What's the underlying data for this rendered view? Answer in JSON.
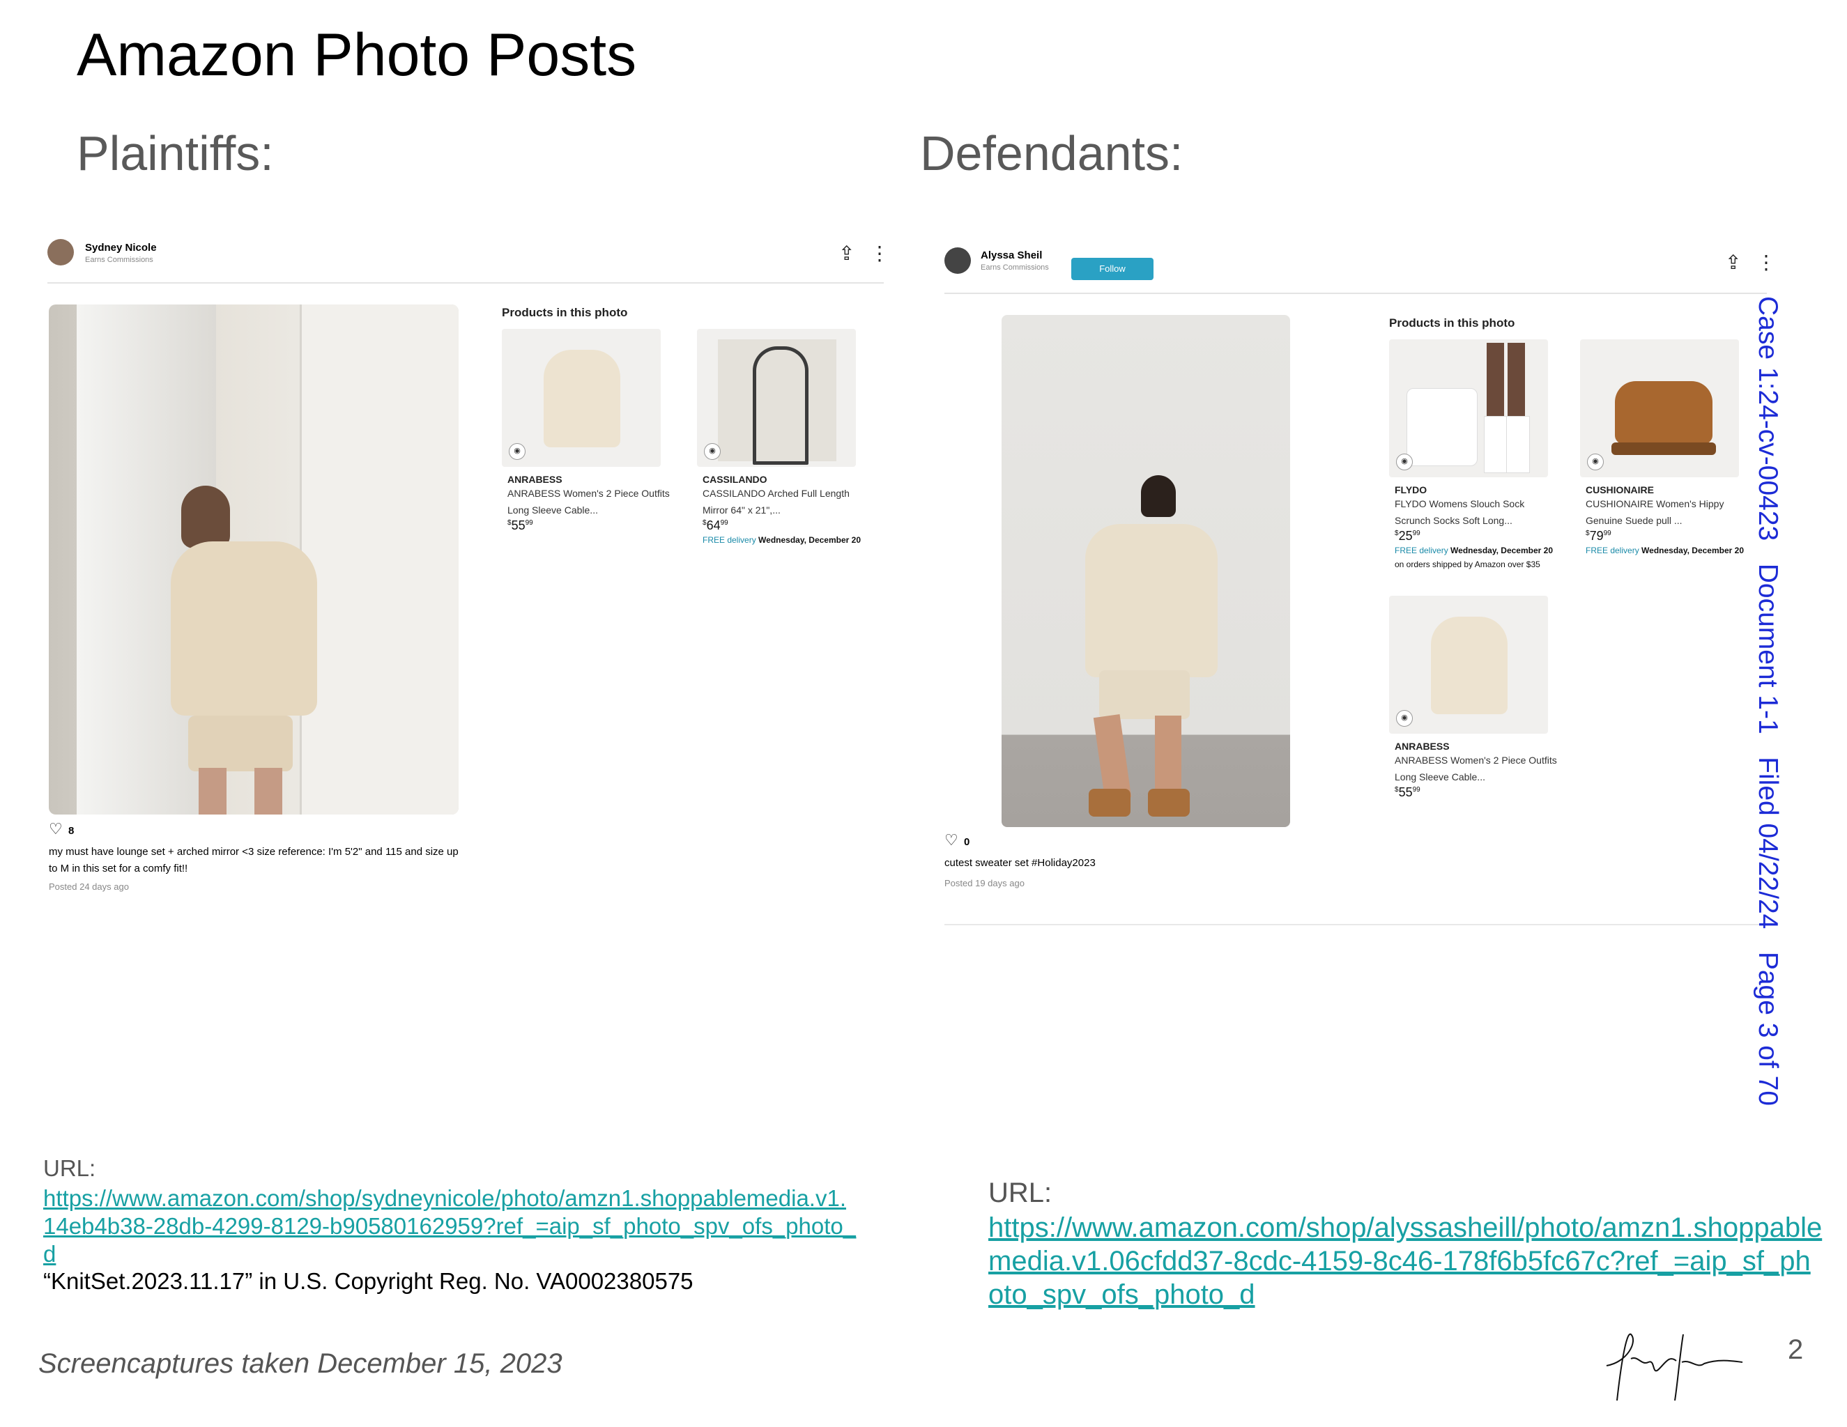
{
  "title": "Amazon Photo Posts",
  "plaintiffs_label": "Plaintiffs:",
  "defendants_label": "Defendants:",
  "left_post": {
    "user": "Sydney Nicole",
    "sub": "Earns Commissions",
    "products_header": "Products in this photo",
    "products": [
      {
        "brand": "ANRABESS",
        "desc": "ANRABESS Women's 2 Piece Outfits Long Sleeve Cable...",
        "price_whole": "55",
        "price_frac": "99"
      },
      {
        "brand": "CASSILANDO",
        "desc": "CASSILANDO Arched Full Length Mirror 64\" x 21\",...",
        "price_whole": "64",
        "price_frac": "99",
        "delivery_free": "FREE delivery",
        "delivery_date": "Wednesday, December 20"
      }
    ],
    "likes": "8",
    "caption": "my must have lounge set + arched mirror <3 size reference: I'm 5'2\" and 115 and size up to M in this set for a comfy fit!!",
    "posted": "Posted 24 days ago"
  },
  "right_post": {
    "user": "Alyssa Sheil",
    "sub": "Earns Commissions",
    "follow": "Follow",
    "products_header": "Products in this photo",
    "products": [
      {
        "brand": "FLYDO",
        "desc": "FLYDO Womens Slouch Sock Scrunch Socks Soft Long...",
        "price_whole": "25",
        "price_frac": "99",
        "delivery_free": "FREE delivery",
        "delivery_date": "Wednesday, December 20",
        "delivery_extra": "on orders shipped by Amazon over $35"
      },
      {
        "brand": "CUSHIONAIRE",
        "desc": "CUSHIONAIRE Women's Hippy Genuine Suede pull ...",
        "price_whole": "79",
        "price_frac": "99",
        "delivery_free": "FREE delivery",
        "delivery_date": "Wednesday, December 20"
      },
      {
        "brand": "ANRABESS",
        "desc": "ANRABESS Women's 2 Piece Outfits Long Sleeve Cable...",
        "price_whole": "55",
        "price_frac": "99"
      }
    ],
    "likes": "0",
    "caption": "cutest sweater set #Holiday2023",
    "posted": "Posted 19 days ago"
  },
  "left_url_label": "URL:",
  "left_url_line1": "https://www.amazon.com/shop/sydneynicole/photo/amzn1.shoppablemedia.v1.",
  "left_url_line2": "14eb4b38-28db-4299-8129-b90580162959?ref_=aip_sf_photo_spv_ofs_photo_",
  "left_url_line3": "d",
  "copyright": "“KnitSet.2023.11.17” in U.S. Copyright Reg. No. VA0002380575",
  "right_url_label": "URL:",
  "right_url_line1": "https://www.amazon.com/shop/alyssasheill/photo/amzn1.shoppable",
  "right_url_line2": "media.v1.06cfdd37-8cdc-4159-8c46-178f6b5fc67c?ref_=aip_sf_ph",
  "right_url_line3": "oto_spv_ofs_photo_d",
  "case_header": "Case 1:24-cv-00423   Document 1-1   Filed 04/22/24   Page 3 of 70",
  "footer": "Screencaptures taken December 15, 2023",
  "page_number": "2",
  "colors": {
    "link": "#17a0a3",
    "case_header": "#1c2bd6",
    "follow": "#2aa1c4"
  }
}
